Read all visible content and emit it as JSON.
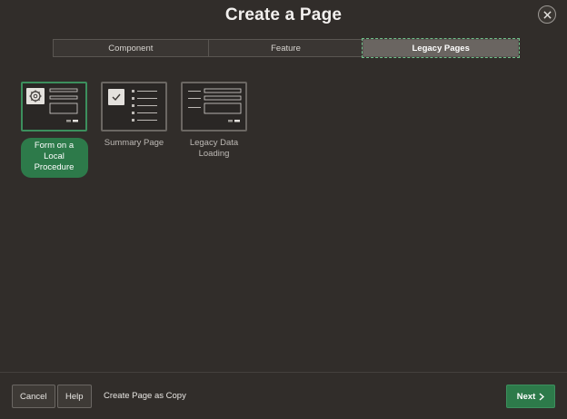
{
  "dialog": {
    "title": "Create a Page"
  },
  "tabs": [
    {
      "label": "Component",
      "active": false
    },
    {
      "label": "Feature",
      "active": false
    },
    {
      "label": "Legacy Pages",
      "active": true
    }
  ],
  "options": [
    {
      "label": "Form on a Local Procedure",
      "icon": "gear-icon",
      "selected": true
    },
    {
      "label": "Summary Page",
      "icon": "checkmark-icon",
      "selected": false
    },
    {
      "label": "Legacy Data Loading",
      "icon": "form-icon",
      "selected": false
    }
  ],
  "footer": {
    "cancel_label": "Cancel",
    "help_label": "Help",
    "copy_label": "Create Page as Copy",
    "next_label": "Next"
  },
  "colors": {
    "accent": "#2d7a4a",
    "background": "#312d2a"
  }
}
